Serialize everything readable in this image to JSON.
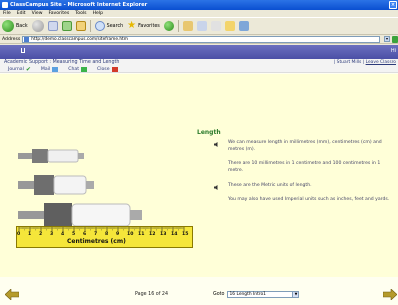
{
  "window": {
    "title": "ClassCampus Site - Microsoft Internet Explorer",
    "controls": [
      "minimize",
      "maximize",
      "close"
    ]
  },
  "menu": {
    "items": [
      "File",
      "Edit",
      "View",
      "Favorites",
      "Tools",
      "Help"
    ]
  },
  "toolbar": {
    "back_label": "Back",
    "search_label": "Search",
    "favorites_label": "Favorites"
  },
  "address": {
    "label": "Address",
    "url": "http://demo.classcampus.com/siteframe.htm"
  },
  "site": {
    "band_right_text": "Hi",
    "breadcrumb": "Academic Support : Measuring Time and Length",
    "user_name": "| Stuart Mills",
    "user_separator": "|",
    "leave_link": "Leave Classro",
    "tools": [
      "Journal",
      "Mail",
      "Chat",
      "Close"
    ]
  },
  "lesson": {
    "title": "Length",
    "paragraphs": [
      "We can measure length in millimetres (mm), centimetres (cm) and metres (m).",
      "There are 10 millimetres in 1 centimetre and 100 centimetres in 1 metre.",
      "These are the Metric units of length.",
      "You may also have used Imperial units such as inches, feet and yards."
    ],
    "ruler_label": "Centimetres (cm)",
    "ruler_ticks": [
      "0",
      "1",
      "2",
      "3",
      "4",
      "5",
      "6",
      "7",
      "8",
      "9",
      "10",
      "11",
      "12",
      "13",
      "14",
      "15"
    ]
  },
  "footer": {
    "page_text": "Page 16 of 24",
    "goto_label": "Goto",
    "goto_value": "16 Length Intro1"
  },
  "colors": {
    "band": "#5b5fb3",
    "lesson_title": "#2a7a2a",
    "ruler": "#f5e63a",
    "page_bg": "#ffffd8"
  }
}
